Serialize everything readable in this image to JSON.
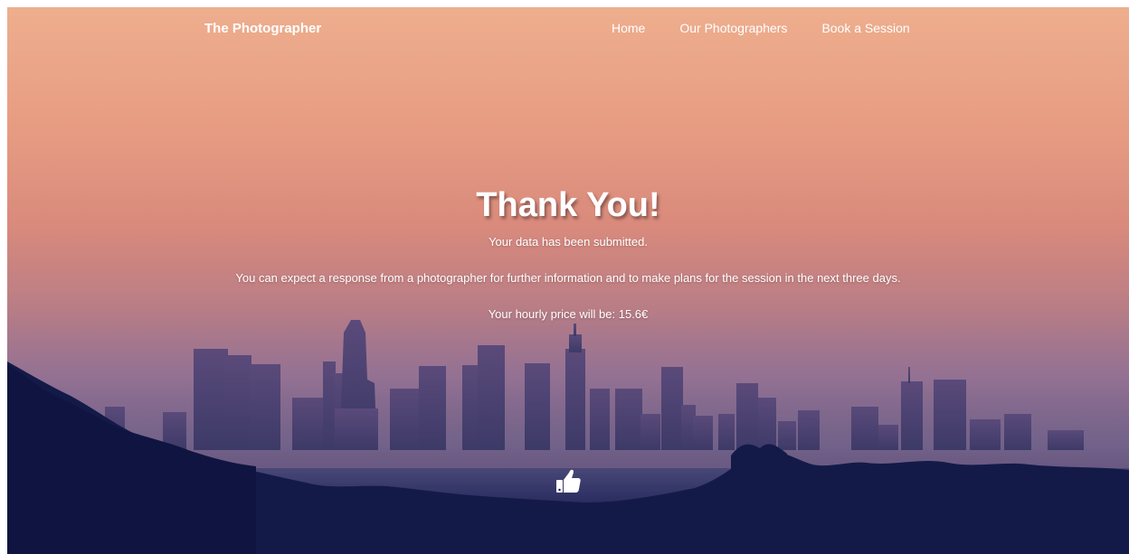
{
  "navbar": {
    "brand": "The Photographer",
    "links": [
      {
        "label": "Home"
      },
      {
        "label": "Our Photographers"
      },
      {
        "label": "Book a Session"
      }
    ]
  },
  "main": {
    "title": "Thank You!",
    "submitted_message": "Your data has been submitted.",
    "response_message": "You can expect a response from a photographer for further information and to make plans for the session in the next three days.",
    "price_message": "Your hourly price will be: 15.6€"
  },
  "icons": {
    "thumb": "thumbs-up-icon"
  },
  "colors": {
    "sky_top": "#eeae8e",
    "sky_mid": "#d98a7c",
    "haze": "#8f7094",
    "hills": "#141a48",
    "text": "#ffffff"
  }
}
